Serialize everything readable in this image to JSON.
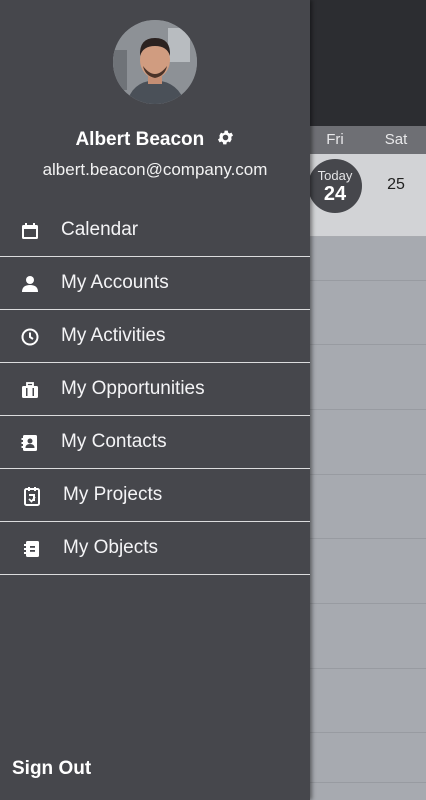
{
  "calendar": {
    "day_headers": [
      "Fri",
      "Sat"
    ],
    "today_label": "Today",
    "today_date": "24",
    "next_date": "25"
  },
  "drawer": {
    "user": {
      "name": "Albert Beacon",
      "email": "albert.beacon@company.com"
    },
    "menu": [
      {
        "label": "Calendar",
        "icon": "calendar-icon"
      },
      {
        "label": "My Accounts",
        "icon": "person-icon"
      },
      {
        "label": "My Activities",
        "icon": "clock-icon"
      },
      {
        "label": "My Opportunities",
        "icon": "briefcase-icon"
      },
      {
        "label": "My Contacts",
        "icon": "contact-card-icon"
      },
      {
        "label": "My Projects",
        "icon": "project-clipboard-icon"
      },
      {
        "label": "My Objects",
        "icon": "notebook-icon"
      }
    ],
    "sign_out": "Sign Out"
  },
  "colors": {
    "drawer_bg": "#46474c",
    "text": "#ffffff",
    "divider": "#dcdcde"
  }
}
